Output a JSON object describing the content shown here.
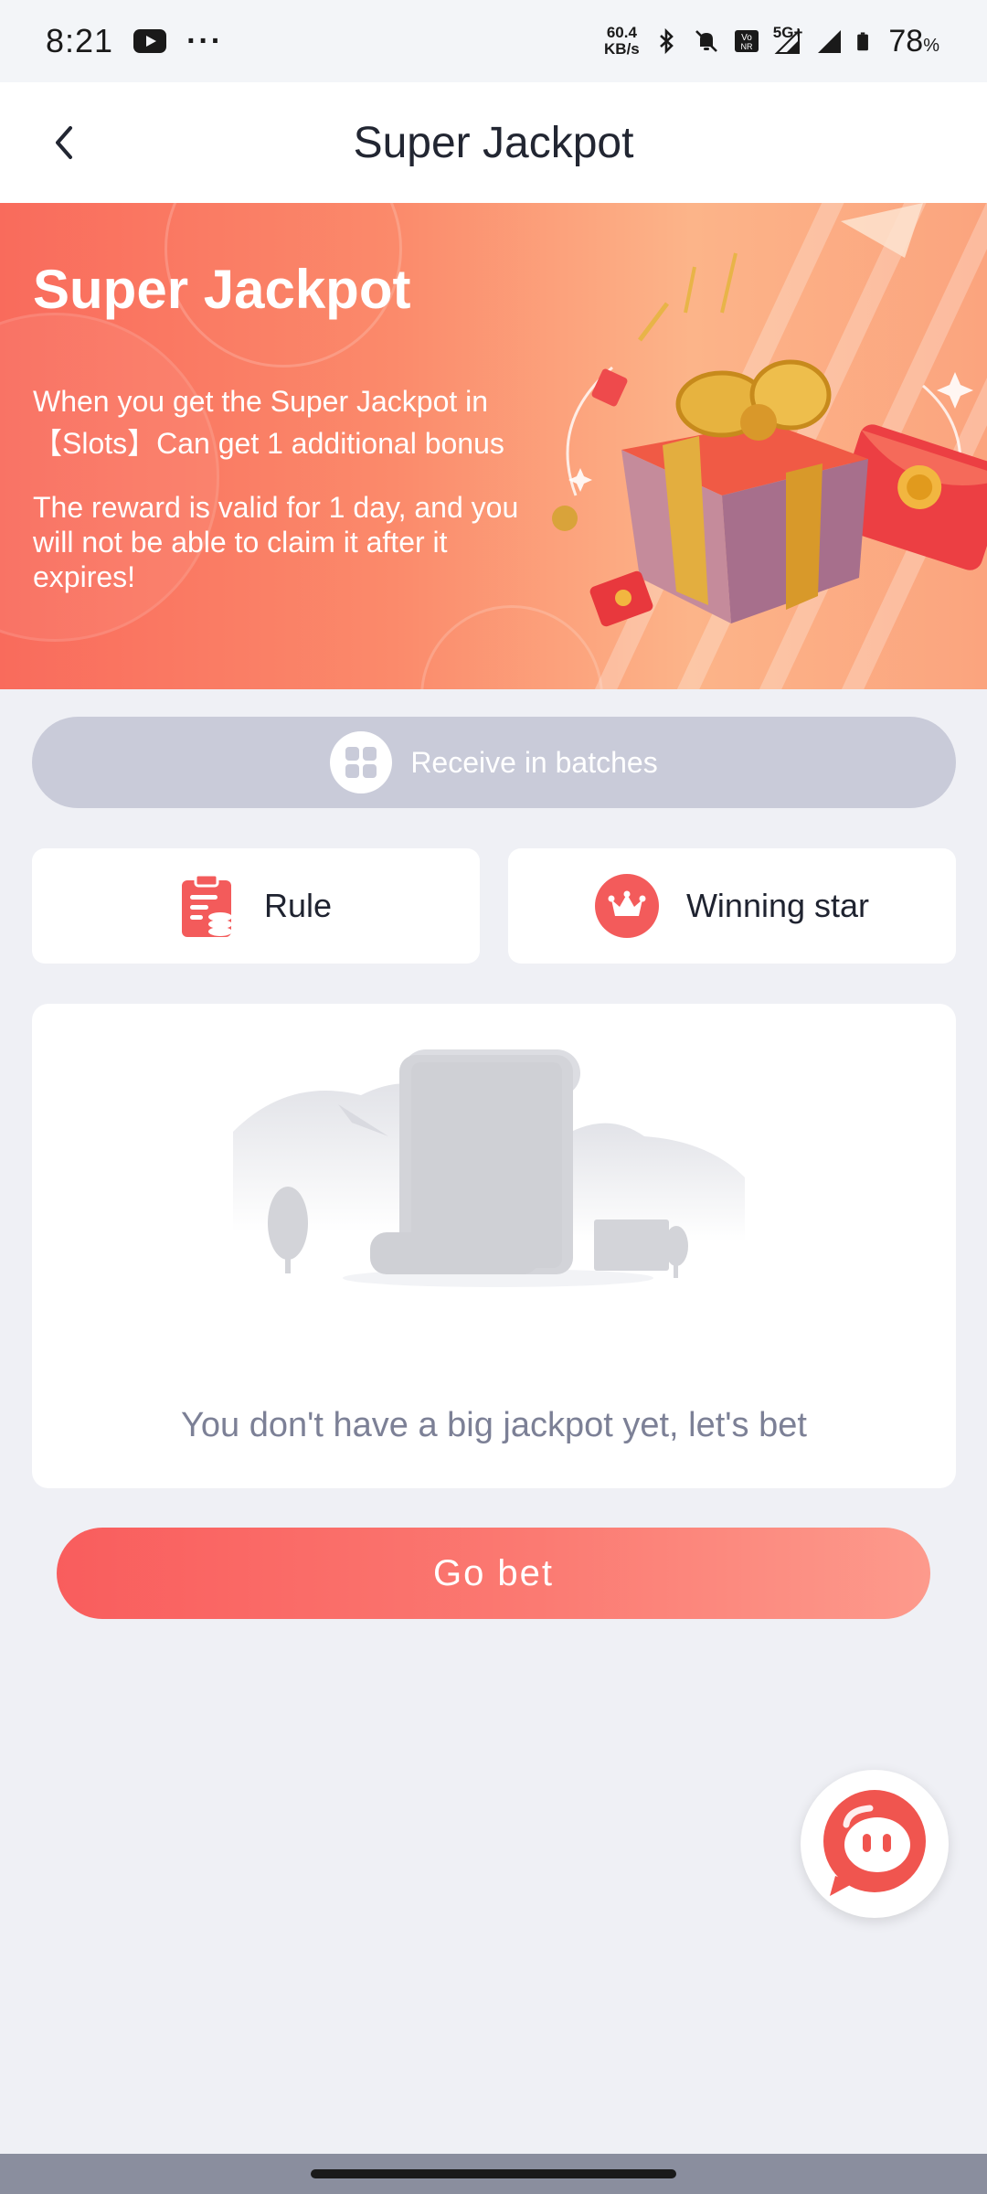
{
  "status_bar": {
    "time": "8:21",
    "dots": "···",
    "speed_value": "60.4",
    "speed_unit": "KB/s",
    "network": "5G+",
    "battery": "78",
    "battery_unit": "%"
  },
  "nav": {
    "title": "Super Jackpot"
  },
  "banner": {
    "title": "Super Jackpot",
    "line1": "When you get the Super Jackpot in 【Slots】Can get 1 additional bonus",
    "line2": "The reward is valid for 1 day, and you will not be able to claim it after it expires!"
  },
  "batch_button": {
    "label": "Receive in batches"
  },
  "actions": {
    "rule_label": "Rule",
    "winning_star_label": "Winning star"
  },
  "empty_state": {
    "message": "You don't have a big jackpot yet, let's bet"
  },
  "go_bet": {
    "label": "Go bet"
  },
  "icons": {
    "back": "chevron-left-icon",
    "batch": "grid-icon",
    "rule": "clipboard-coins-icon",
    "star": "crown-icon",
    "chat": "chat-bubble-icon"
  },
  "colors": {
    "accent": "#f95d5d",
    "page_bg": "#eff0f5",
    "batch_bg": "#c9cbd9"
  }
}
